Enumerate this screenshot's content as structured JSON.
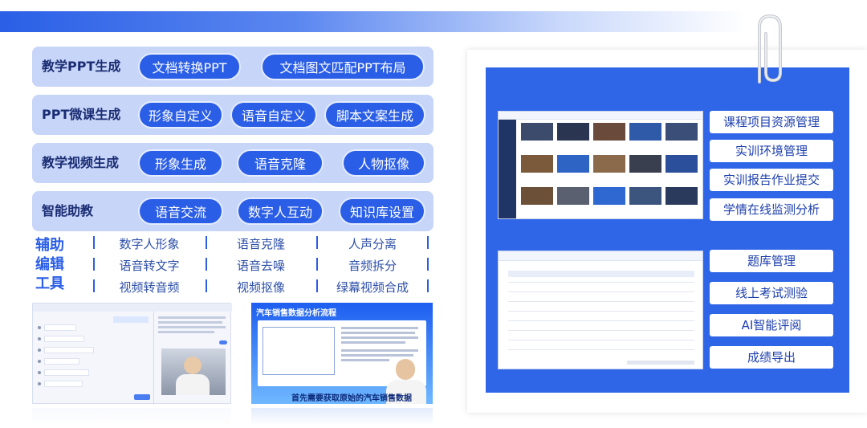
{
  "rows": [
    {
      "label": "教学PPT生成",
      "pills": [
        "文档转换PPT",
        "文档图文匹配PPT布局"
      ]
    },
    {
      "label": "PPT微课生成",
      "pills": [
        "形象自定义",
        "语音自定义",
        "脚本文案生成"
      ]
    },
    {
      "label": "教学视频生成",
      "pills": [
        "形象生成",
        "语音克隆",
        "人物抠像"
      ]
    },
    {
      "label": "智能助教",
      "pills": [
        "语音交流",
        "数字人互动",
        "知识库设置"
      ]
    }
  ],
  "tools": {
    "title": [
      "辅助",
      "编辑",
      "工具"
    ],
    "items": [
      "数字人形象",
      "语音克隆",
      "人声分离",
      "语音转文字",
      "语音去噪",
      "音频拆分",
      "视频转音频",
      "视频抠像",
      "绿幕视频合成"
    ]
  },
  "thumb2": {
    "title": "汽车销售数据分析流程",
    "caption": "首先需要获取原始的汽车销售数据"
  },
  "features": {
    "group1": [
      "课程项目资源管理",
      "实训环境管理",
      "实训报告作业提交",
      "学情在线监测分析"
    ],
    "group2": [
      "题库管理",
      "线上考试测验",
      "AI智能评阅",
      "成绩导出"
    ]
  },
  "colors": {
    "accent": "#2b5ee6",
    "panel": "#2f66e8",
    "row_bg": "#c7d5f8"
  }
}
